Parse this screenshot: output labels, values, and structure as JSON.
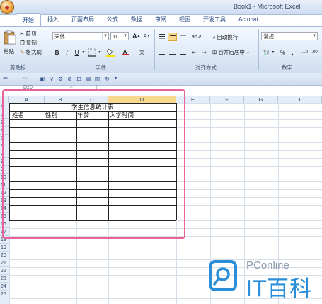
{
  "window": {
    "title": "Book1 - Microsoft Excel"
  },
  "tabs": [
    "开始",
    "插入",
    "页面布局",
    "公式",
    "数据",
    "审阅",
    "视图",
    "开发工具",
    "Acrobat"
  ],
  "active_tab": "开始",
  "ribbon": {
    "clipboard": {
      "paste": "粘贴",
      "cut": "剪切",
      "copy": "复制",
      "format_painter": "格式刷",
      "label": "剪贴板"
    },
    "font": {
      "name": "宋体",
      "size": "11",
      "bold": "B",
      "italic": "I",
      "underline": "U",
      "grow": "A",
      "shrink": "A",
      "font_color": "A",
      "label": "字体"
    },
    "alignment": {
      "wrap": "自动换行",
      "merge": "合并后居中",
      "label": "对齐方式"
    },
    "number": {
      "format": "常规",
      "percent": "%",
      "comma": ",",
      "label": "数字"
    }
  },
  "namebox_ghost": "D20",
  "columns": [
    "A",
    "B",
    "C",
    "D",
    "E",
    "F",
    "G",
    "I"
  ],
  "rows": [
    "1",
    "2",
    "3",
    "4",
    "5",
    "6",
    "7",
    "8",
    "9",
    "10",
    "11",
    "12",
    "13",
    "14",
    "15",
    "16",
    "17",
    "18",
    "19",
    "20",
    "21",
    "22",
    "23",
    "24",
    "25"
  ],
  "table": {
    "title": "学生信息统计表",
    "headers": [
      "姓名",
      "性别",
      "年龄",
      "入学时间"
    ]
  },
  "watermark": {
    "brand": "PConline",
    "name": "IT百科"
  },
  "colors": {
    "highlight": "#e8639a",
    "brand": "#2a8fd8",
    "selected_header": "#f8d88f"
  }
}
